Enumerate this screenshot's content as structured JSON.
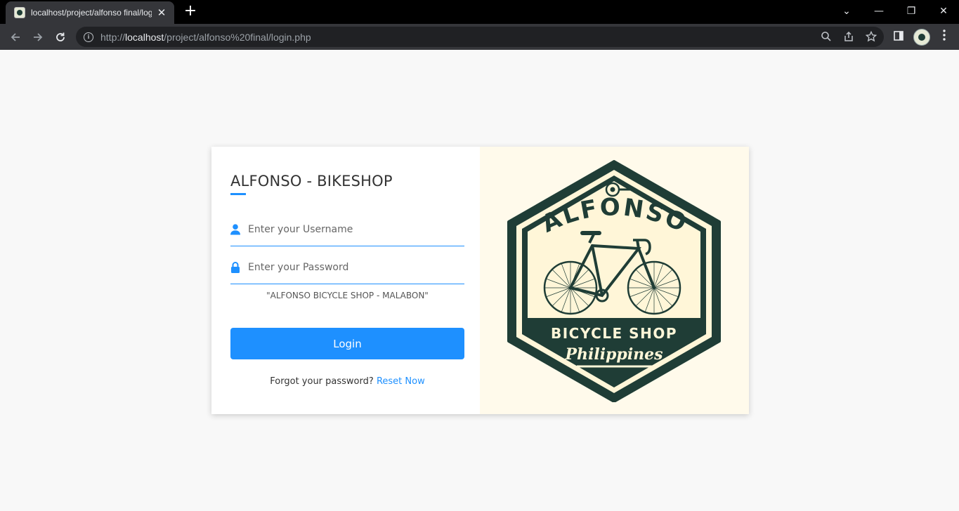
{
  "browser": {
    "tab_title": "localhost/project/alfonso final/login.php",
    "tab_close": "✕",
    "new_tab": "+",
    "url_scheme": "http://",
    "url_host": "localhost",
    "url_path": "/project/alfonso%20final/login.php",
    "controls": {
      "dropdown": "⌄",
      "minimize": "—",
      "restore": "❐",
      "close": "✕"
    }
  },
  "login": {
    "title": "ALFONSO - BIKESHOP",
    "username_placeholder": "Enter your Username",
    "password_placeholder": "Enter your Password",
    "slogan": "\"ALFONSO BICYCLE SHOP - MALABON\"",
    "login_label": "Login",
    "forgot_text": "Forgot your password?",
    "reset_link": "Reset Now"
  },
  "logo": {
    "top_text": "ALFONSO",
    "middle_text": "BICYCLE SHOP",
    "bottom_text": "Philippines"
  },
  "colors": {
    "accent": "#1e90ff",
    "logo_dark": "#1f3d36",
    "logo_cream": "#fff6d8"
  },
  "icons": {
    "username": "user-icon",
    "password": "lock-icon"
  }
}
